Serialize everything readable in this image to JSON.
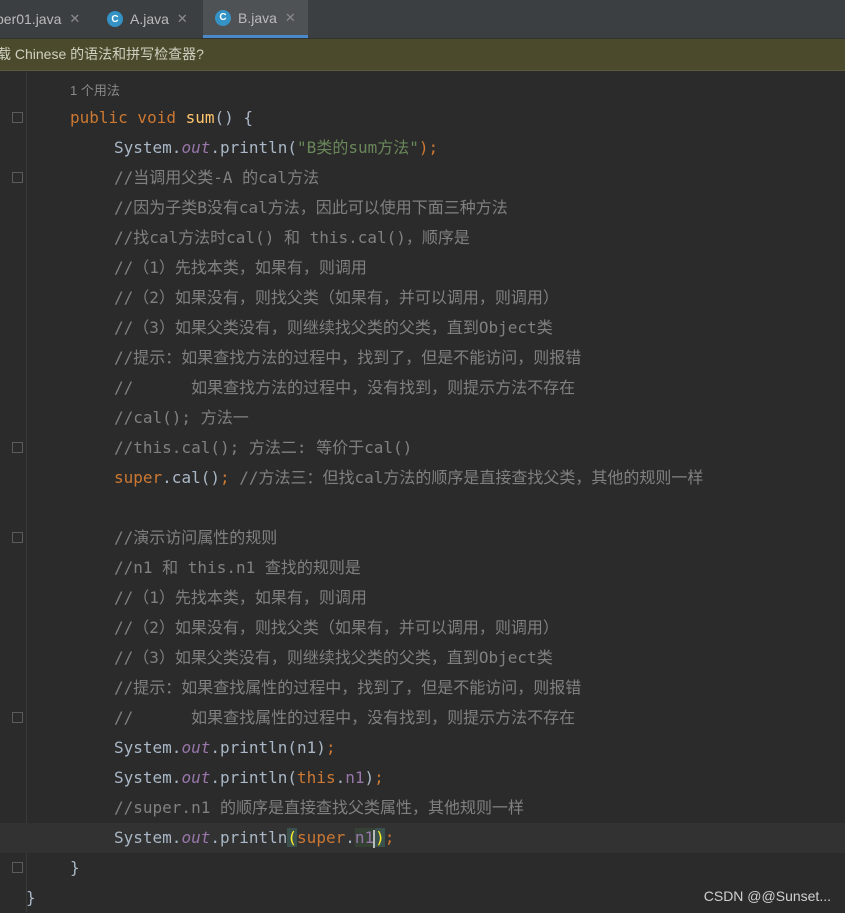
{
  "tabs": [
    {
      "label": "per01.java",
      "has_icon": false,
      "active": false
    },
    {
      "label": "A.java",
      "has_icon": true,
      "active": false
    },
    {
      "label": "B.java",
      "has_icon": true,
      "active": true
    }
  ],
  "tab_icon_letter": "C",
  "notification": "载 Chinese 的语法和拼写检查器?",
  "usages_hint": "1 个用法",
  "code": {
    "l1_kw": "public void ",
    "l1_fn": "sum",
    "l1_rest": "() {",
    "l2_a": "System.",
    "l2_b": "out",
    "l2_c": ".println(",
    "l2_str": "\"B类的sum方法\"",
    "l2_d": ");",
    "l3": "//当调用父类-A 的cal方法",
    "l4": "//因为子类B没有cal方法，因此可以使用下面三种方法",
    "l5": "//找cal方法时cal() 和 this.cal()，顺序是",
    "l6": "//（1）先找本类，如果有，则调用",
    "l7": "//（2）如果没有，则找父类（如果有，并可以调用，则调用）",
    "l8": "//（3）如果父类没有，则继续找父类的父类，直到Object类",
    "l9": "//提示：如果查找方法的过程中，找到了，但是不能访问，则报错",
    "l10": "//      如果查找方法的过程中，没有找到，则提示方法不存在",
    "l11": "//cal(); 方法一",
    "l12": "//this.cal(); 方法二: 等价于cal()",
    "l13_kw": "super",
    "l13_mid": ".cal()",
    "l13_semi": ";",
    "l13_cm": " //方法三：但找cal方法的顺序是直接查找父类，其他的规则一样",
    "l15": "//演示访问属性的规则",
    "l16": "//n1 和 this.n1 查找的规则是",
    "l17": "//（1）先找本类，如果有，则调用",
    "l18": "//（2）如果没有，则找父类（如果有，并可以调用，则调用）",
    "l19": "//（3）如果父类没有，则继续找父类的父类，直到Object类",
    "l20": "//提示：如果查找属性的过程中，找到了，但是不能访问，则报错",
    "l21": "//      如果查找属性的过程中，没有找到，则提示方法不存在",
    "l22_a": "System.",
    "l22_b": "out",
    "l22_c": ".println(n1)",
    "l22_d": ";",
    "l23_a": "System.",
    "l23_b": "out",
    "l23_c": ".println(",
    "l23_this": "this",
    "l23_dot": ".",
    "l23_fld": "n1",
    "l23_close": ")",
    "l23_semi": ";",
    "l24": "//super.n1 的顺序是直接查找父类属性，其他规则一样",
    "l25_a": "System.",
    "l25_b": "out",
    "l25_c": ".println",
    "l25_open": "(",
    "l25_super": "super",
    "l25_dot": ".",
    "l25_fld": "n1",
    "l25_close": ")",
    "l25_semi": ";",
    "l26": "}",
    "l27": "}"
  },
  "watermark": "CSDN @@Sunset..."
}
